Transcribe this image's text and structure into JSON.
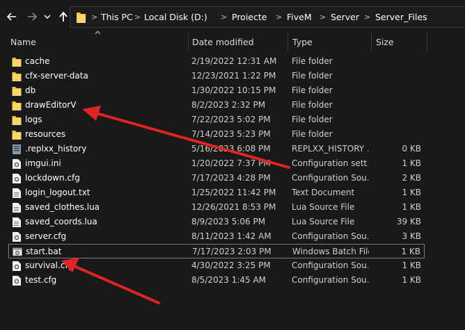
{
  "breadcrumb": [
    "This PC",
    "Local Disk (D:)",
    "Proiecte",
    "FiveM",
    "Server",
    "Server_Files"
  ],
  "columns": {
    "name": "Name",
    "date": "Date modified",
    "type": "Type",
    "size": "Size"
  },
  "files": [
    {
      "name": "cache",
      "date": "2/19/2022 12:31 AM",
      "type": "File folder",
      "size": "",
      "icon": "folder-icon"
    },
    {
      "name": "cfx-server-data",
      "date": "12/23/2021 1:22 PM",
      "type": "File folder",
      "size": "",
      "icon": "folder-icon"
    },
    {
      "name": "db",
      "date": "1/30/2022 10:15 PM",
      "type": "File folder",
      "size": "",
      "icon": "folder-icon"
    },
    {
      "name": "drawEditorV",
      "date": "8/2/2023 2:32 PM",
      "type": "File folder",
      "size": "",
      "icon": "folder-icon"
    },
    {
      "name": "logs",
      "date": "7/22/2023 5:02 PM",
      "type": "File folder",
      "size": "",
      "icon": "folder-icon"
    },
    {
      "name": "resources",
      "date": "7/14/2023 5:23 PM",
      "type": "File folder",
      "size": "",
      "icon": "folder-icon"
    },
    {
      "name": ".replxx_history",
      "date": "5/16/2023 6:08 PM",
      "type": "REPLXX_HISTORY ...",
      "size": "0 KB",
      "icon": "generic-file-icon"
    },
    {
      "name": "imgui.ini",
      "date": "1/20/2022 7:37 PM",
      "type": "Configuration sett...",
      "size": "1 KB",
      "icon": "settings-file-icon"
    },
    {
      "name": "lockdown.cfg",
      "date": "7/17/2023 4:28 PM",
      "type": "Configuration Sou...",
      "size": "2 KB",
      "icon": "config-file-icon"
    },
    {
      "name": "login_logout.txt",
      "date": "1/25/2022 11:42 PM",
      "type": "Text Document",
      "size": "1 KB",
      "icon": "text-file-icon"
    },
    {
      "name": "saved_clothes.lua",
      "date": "12/26/2021 8:53 PM",
      "type": "Lua Source File",
      "size": "1 KB",
      "icon": "text-file-icon"
    },
    {
      "name": "saved_coords.lua",
      "date": "8/9/2023 5:06 PM",
      "type": "Lua Source File",
      "size": "39 KB",
      "icon": "text-file-icon"
    },
    {
      "name": "server.cfg",
      "date": "8/11/2023 1:42 AM",
      "type": "Configuration Sou...",
      "size": "3 KB",
      "icon": "config-file-icon"
    },
    {
      "name": "start.bat",
      "date": "7/17/2023 2:03 PM",
      "type": "Windows Batch File",
      "size": "1 KB",
      "icon": "batch-file-icon",
      "selected": true
    },
    {
      "name": "survival.cfg",
      "date": "4/30/2022 3:25 PM",
      "type": "Configuration Sou...",
      "size": "1 KB",
      "icon": "config-file-icon"
    },
    {
      "name": "test.cfg",
      "date": "8/5/2023 1:45 AM",
      "type": "Configuration Sou...",
      "size": "1 KB",
      "icon": "config-file-icon"
    }
  ],
  "colors": {
    "background": "#191919",
    "folder": "#f5c542",
    "arrow": "#e02424",
    "selected_border": "#7a7a7a"
  }
}
